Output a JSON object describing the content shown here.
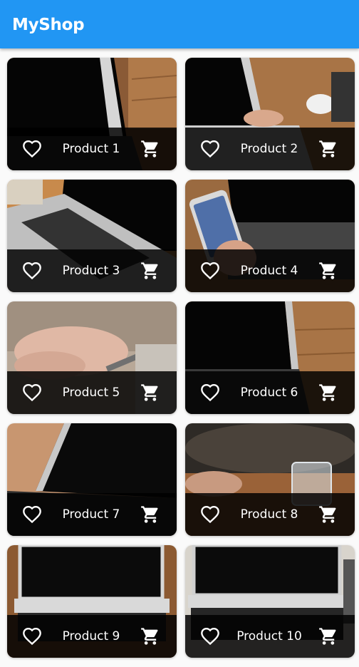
{
  "app": {
    "title": "MyShop"
  },
  "products": [
    {
      "name": "Product 1",
      "photo": "laptop-on-desk"
    },
    {
      "name": "Product 2",
      "photo": "laptop-typing-coffee"
    },
    {
      "name": "Product 3",
      "photo": "laptop-keyboard-closeup"
    },
    {
      "name": "Product 4",
      "photo": "phone-over-laptop"
    },
    {
      "name": "Product 5",
      "photo": "hand-holding-pen"
    },
    {
      "name": "Product 6",
      "photo": "laptop-on-desk"
    },
    {
      "name": "Product 7",
      "photo": "laptop-screen-angle"
    },
    {
      "name": "Product 8",
      "photo": "glass-of-water-bag"
    },
    {
      "name": "Product 9",
      "photo": "laptop-front-view"
    },
    {
      "name": "Product 10",
      "photo": "laptop-front-view"
    }
  ],
  "icons": {
    "favorite": "heart-outline-icon",
    "cart": "shopping-cart-icon"
  },
  "colors": {
    "appbar": "#2196f3",
    "footer": "#000000"
  }
}
